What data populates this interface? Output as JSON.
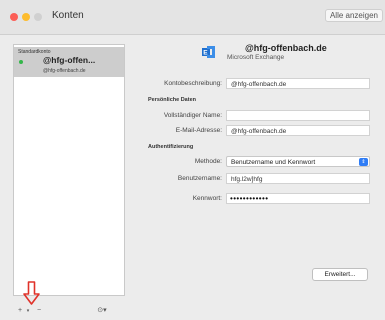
{
  "window": {
    "title": "Konten",
    "show_all": "Alle anzeigen"
  },
  "sidebar": {
    "section_label": "Standardkonto",
    "account": {
      "name": "@hfg-offen...",
      "email": "@hfg-offenbach.de"
    },
    "footer": {
      "add": "+",
      "add_menu": "▾",
      "remove": "−",
      "action": "⊙▾"
    }
  },
  "header": {
    "email": "@hfg-offenbach.de",
    "type": "Microsoft Exchange"
  },
  "form": {
    "description_label": "Kontobeschreibung:",
    "description_value": "@hfg-offenbach.de",
    "personal_section": "Persönliche Daten",
    "fullname_label": "Vollständiger Name:",
    "fullname_value": "",
    "email_label": "E-Mail-Adresse:",
    "email_value": "@hfg-offenbach.de",
    "auth_section": "Authentifizierung",
    "method_label": "Methode:",
    "method_value": "Benutzername und Kennwort",
    "username_label": "Benutzername:",
    "username_value": "hfg.l2w]hfg",
    "password_label": "Kennwort:",
    "password_value": "••••••••••••"
  },
  "advanced_button": "Erweitert...",
  "icons": {
    "exchange": "exchange-logo-icon",
    "arrow": "red-down-arrow-icon"
  },
  "colors": {
    "accent": "#2f7df6",
    "status_dot": "#34b64a",
    "arrow": "#e0322a"
  }
}
